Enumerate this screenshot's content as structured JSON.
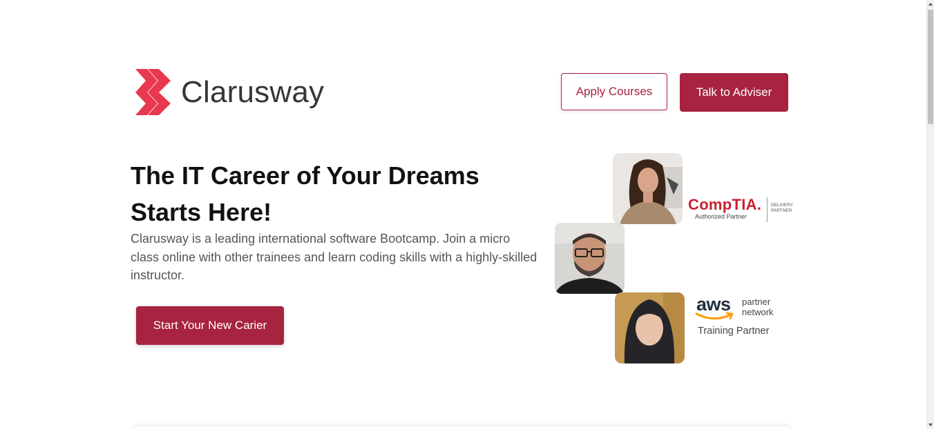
{
  "brand": {
    "name": "Clarusway",
    "accent_color": "#a7233f",
    "logo_color": "#e8384f"
  },
  "header": {
    "apply_label": "Apply Courses",
    "adviser_label": "Talk to Adviser"
  },
  "hero": {
    "title_line1": "The IT Career of Your Dreams",
    "title_line2": "Starts Here!",
    "description": "Clarusway is a leading international software Bootcamp. Join a micro class online with other trainees and learn coding skills with a highly-skilled instructor.",
    "cta_label": "Start Your New Carier"
  },
  "partners": {
    "comptia": {
      "name": "CompTIA.",
      "subtitle": "Authorized Partner",
      "side_text": "DELIVERY PARTNER"
    },
    "aws": {
      "name": "aws",
      "partner_text_line1": "partner",
      "partner_text_line2": "network",
      "training_text": "Training Partner"
    }
  },
  "photos": [
    {
      "icon": "instructor-photo-woman"
    },
    {
      "icon": "instructor-photo-man"
    },
    {
      "icon": "instructor-photo-woman-hijab"
    }
  ]
}
